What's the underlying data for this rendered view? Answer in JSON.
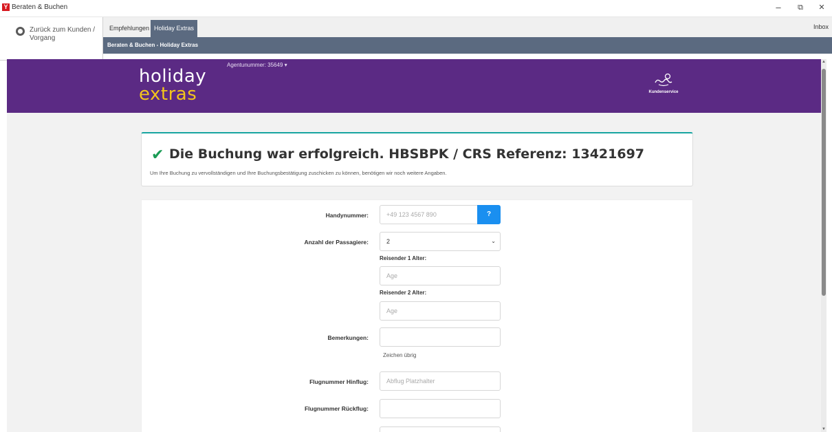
{
  "window": {
    "app_icon": "Y",
    "title": "Beraten & Buchen",
    "minimize_icon": "–",
    "restore_icon": "⧉",
    "close_icon": "✕"
  },
  "back": {
    "label": "Zurück zum Kunden / Vorgang"
  },
  "tabs": [
    {
      "label": "Empfehlungen",
      "active": false
    },
    {
      "label": "Holiday Extras",
      "active": true
    }
  ],
  "inbox_label": "Inbox",
  "breadcrumb": "Beraten & Buchen - Holiday Extras",
  "header": {
    "logo_line1": "holiday",
    "logo_line2": "extras",
    "agent_label": "Agentunummer: 35649 ▾",
    "service_label": "Kundenservice",
    "service_icon": "customer-service-icon"
  },
  "success": {
    "title": "Die Buchung war erfolgreich. HBSBPK / CRS Referenz: 13421697",
    "subtitle": "Um Ihre Buchung zu vervollständigen und Ihre Buchungsbestätigung zuschicken zu können, benötigen wir noch weitere Angaben."
  },
  "form": {
    "phone_label": "Handynummer:",
    "phone_placeholder": "+49 123 4567 890",
    "help_label": "?",
    "passengers_label": "Anzahl der Passagiere:",
    "passengers_value": "2",
    "traveler1_label": "Reisender 1 Alter:",
    "traveler2_label": "Reisender 2 Alter:",
    "age_placeholder": "Age",
    "remarks_label": "Bemerkungen:",
    "chars_left": "Zeichen übrig",
    "flight_out_label": "Flugnummer Hinflug:",
    "flight_out_placeholder": "Abflug Platzhalter",
    "flight_back_label": "Flugnummer Rückflug:"
  },
  "colors": {
    "header_purple": "#5b2a84",
    "logo_yellow": "#f3c51b",
    "nav_slate": "#5b6a80",
    "success_green": "#1a9b55",
    "help_blue": "#1a8ff0"
  }
}
